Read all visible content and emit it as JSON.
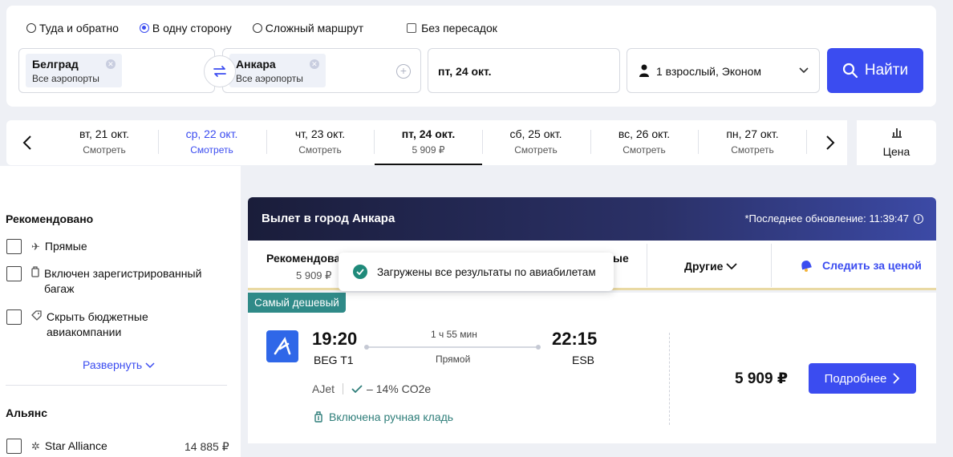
{
  "search": {
    "trip_types": [
      {
        "label": "Туда и обратно",
        "checked": false
      },
      {
        "label": "В одну сторону",
        "checked": true
      },
      {
        "label": "Сложный маршрут",
        "checked": false
      }
    ],
    "nonstop_label": "Без пересадок",
    "origin": {
      "city": "Белград",
      "airports": "Все аэропорты"
    },
    "destination": {
      "city": "Анкара",
      "airports": "Все аэропорты"
    },
    "date": "пт, 24 окт.",
    "passengers": "1 взрослый, Эконом",
    "search_button": "Найти",
    "accent_color": "#3b4cf0"
  },
  "date_strip": {
    "days": [
      {
        "label": "вт, 21 окт.",
        "sub": "Смотреть"
      },
      {
        "label": "ср, 22 окт.",
        "sub": "Смотреть"
      },
      {
        "label": "чт, 23 окт.",
        "sub": "Смотреть"
      },
      {
        "label": "пт, 24 окт.",
        "sub": "5 909 ₽"
      },
      {
        "label": "сб, 25 окт.",
        "sub": "Смотреть"
      },
      {
        "label": "вс, 26 окт.",
        "sub": "Смотреть"
      },
      {
        "label": "пн, 27 окт.",
        "sub": "Смотреть"
      }
    ],
    "price_sort_label": "Цена"
  },
  "filters": {
    "recommended_title": "Рекомендовано",
    "items": [
      {
        "label": "Прямые"
      },
      {
        "label": "Включен зарегистрированный багаж"
      },
      {
        "label": "Скрыть бюджетные авиакомпании"
      }
    ],
    "expand_label": "Развернуть",
    "alliance_title": "Альянс",
    "alliance": {
      "label": "Star Alliance",
      "price": "14 885 ₽"
    }
  },
  "results": {
    "title": "Вылет в город Анкара",
    "update": "*Последнее обновление: 11:39:47",
    "tabs": {
      "recommended": "Рекомендовано",
      "recommended_price": "5 909 ₽",
      "fastest_tail": "ые",
      "other": "Другие",
      "track": "Следить за ценой"
    },
    "toast": "Загружены все результаты по авиабилетам",
    "ticket": {
      "badge": "Самый дешевый",
      "dep_time": "19:20",
      "dep_airport": "BEG T1",
      "duration": "1 ч 55 мин",
      "stops": "Прямой",
      "arr_time": "22:15",
      "arr_airport": "ESB",
      "carrier": "AJet",
      "co2": "– 14% CO2e",
      "baggage": "Включена ручная кладь",
      "price": "5 909 ₽",
      "details_button": "Подробнее"
    }
  }
}
